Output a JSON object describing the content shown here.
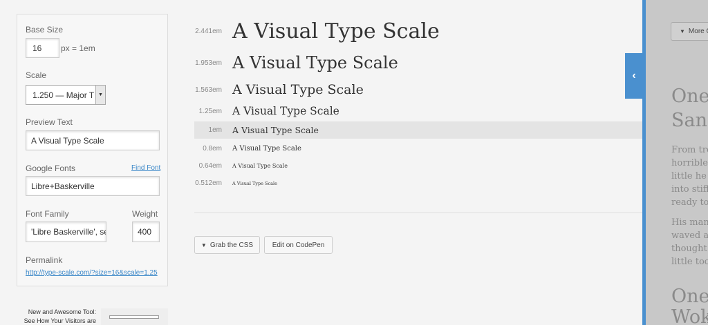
{
  "sidebar": {
    "base_size_label": "Base Size",
    "base_size_value": "16",
    "base_size_unit": "px = 1em",
    "scale_label": "Scale",
    "scale_value": "1.250 — Major T",
    "preview_label": "Preview Text",
    "preview_value": "A Visual Type Scale",
    "google_fonts_label": "Google Fonts",
    "find_font_link": "Find Font",
    "google_fonts_value": "Libre+Baskerville",
    "font_family_label": "Font Family",
    "font_family_value": "'Libre Baskerville', se",
    "weight_label": "Weight",
    "weight_value": "400",
    "permalink_label": "Permalink",
    "permalink_value": "http://type-scale.com/?size=16&scale=1.25"
  },
  "ad": {
    "line1": "New and Awesome Tool:",
    "line2": "See How Your Visitors are"
  },
  "scale_rows": [
    {
      "size": "2.441em",
      "text": "A Visual Type Scale"
    },
    {
      "size": "1.953em",
      "text": "A Visual Type Scale"
    },
    {
      "size": "1.563em",
      "text": "A Visual Type Scale"
    },
    {
      "size": "1.25em",
      "text": "A Visual Type Scale"
    },
    {
      "size": "1em",
      "text": "A Visual Type Scale"
    },
    {
      "size": "0.8em",
      "text": "A Visual Type Scale"
    },
    {
      "size": "0.64em",
      "text": "A Visual Type Scale"
    },
    {
      "size": "0.512em",
      "text": "A Visual Type Scale"
    }
  ],
  "actions": {
    "grab_css": "Grab the CSS",
    "codepen": "Edit on CodePen"
  },
  "panel": {
    "more_label": "More O",
    "heading1_line1": "One",
    "heading1_line2": "San",
    "para1": [
      "From tro",
      "horrible",
      "little he c",
      "into stiff",
      "ready to"
    ],
    "para2": [
      "His man",
      "waved ab",
      "thought.",
      "little too"
    ],
    "heading2_line1": "One",
    "heading2_line2": "Wok"
  },
  "colors": {
    "accent": "#4a90cf",
    "link": "#3a87c8"
  }
}
